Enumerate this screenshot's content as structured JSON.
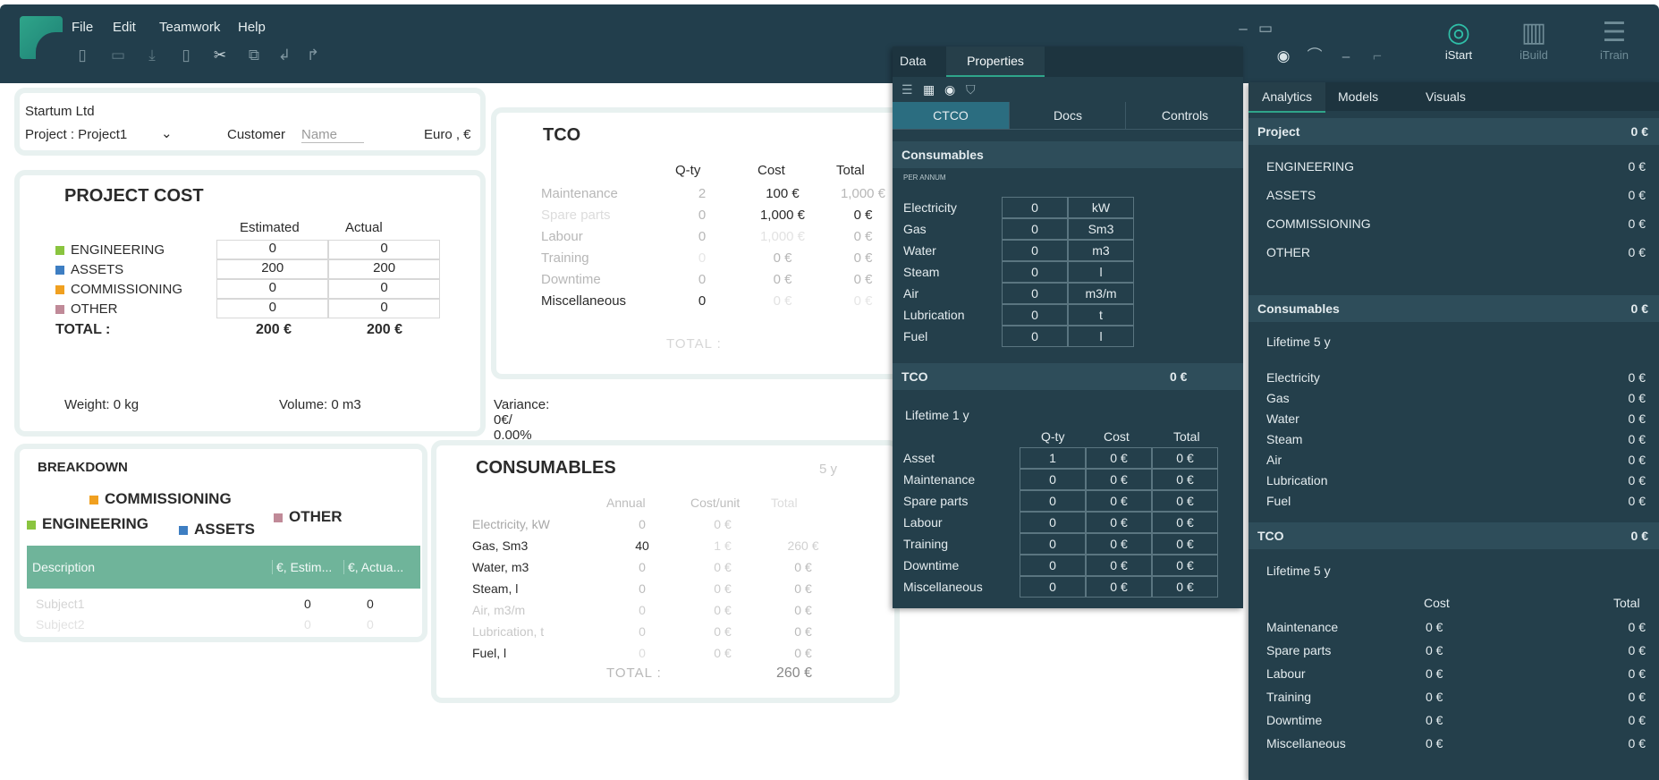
{
  "menu": {
    "file": "File",
    "edit": "Edit",
    "teamwork": "Teamwork",
    "help": "Help"
  },
  "right_toolbar": {
    "istart": "iStart",
    "ibuild": "iBuild",
    "itrain": "iTrain"
  },
  "colors": {
    "engineering": "#8ac43f",
    "assets": "#3e7ec2",
    "commissioning": "#f0a020",
    "other": "#c08a98",
    "accent": "#2fa58a"
  },
  "header": {
    "company": "Startum Ltd",
    "project": "Project : Project1",
    "customer_label": "Customer",
    "customer_placeholder": "Name",
    "currency": "Euro ,  €"
  },
  "project_cost": {
    "title": "PROJECT COST",
    "col_estimated": "Estimated",
    "col_actual": "Actual",
    "rows": [
      {
        "label": "ENGINEERING",
        "estimated": "0",
        "actual": "0"
      },
      {
        "label": "ASSETS",
        "estimated": "200",
        "actual": "200"
      },
      {
        "label": "COMMISSIONING",
        "estimated": "0",
        "actual": "0"
      },
      {
        "label": "OTHER",
        "estimated": "0",
        "actual": "0"
      }
    ],
    "total_label": "TOTAL :",
    "total_estimated": "200 €",
    "total_actual": "200 €",
    "weight": "Weight: 0 kg",
    "volume": "Volume: 0 m3",
    "variance": "Variance: 0€/ 0.00%"
  },
  "tco_card": {
    "title": "TCO",
    "col_qty": "Q-ty",
    "col_cost": "Cost",
    "col_total": "Total",
    "rows": [
      {
        "label": "Maintenance",
        "qty": "2",
        "cost": "100 €",
        "total": "1,000 €"
      },
      {
        "label": "Spare parts",
        "qty": "0",
        "cost": "1,000 €",
        "total": "0 €"
      },
      {
        "label": "Labour",
        "qty": "0",
        "cost": "1,000 €",
        "total": "0 €"
      },
      {
        "label": "Training",
        "qty": "0",
        "cost": "0 €",
        "total": "0 €"
      },
      {
        "label": "Downtime",
        "qty": "0",
        "cost": "0 €",
        "total": "0 €"
      },
      {
        "label": "Miscellaneous",
        "qty": "0",
        "cost": "0 €",
        "total": "0 €"
      }
    ],
    "total_label": "TOTAL :"
  },
  "breakdown": {
    "title": "BREAKDOWN",
    "legend_commissioning": "COMMISSIONING",
    "legend_engineering": "ENGINEERING",
    "legend_assets": "ASSETS",
    "legend_other": "OTHER",
    "col_description": "Description",
    "col_estimated": "€, Estim...",
    "col_actual": "€, Actua...",
    "rows": [
      {
        "description": "Subject1",
        "estimated": "0",
        "actual": "0"
      },
      {
        "description": "Subject2",
        "estimated": "0",
        "actual": "0"
      }
    ]
  },
  "consumables_card": {
    "title": "CONSUMABLES",
    "lifetime": "5  y",
    "col_annual": "Annual",
    "col_cost_unit": "Cost/unit",
    "col_total": "Total",
    "rows": [
      {
        "label": "Electricity, kW",
        "annual": "0",
        "cost": "0 €",
        "total": ""
      },
      {
        "label": "Gas, Sm3",
        "annual": "40",
        "cost": "1 €",
        "total": "260 €"
      },
      {
        "label": "Water, m3",
        "annual": "0",
        "cost": "0 €",
        "total": "0 €"
      },
      {
        "label": "Steam, l",
        "annual": "0",
        "cost": "0 €",
        "total": "0 €"
      },
      {
        "label": "Air, m3/m",
        "annual": "0",
        "cost": "0 €",
        "total": "0 €"
      },
      {
        "label": "Lubrication, t",
        "annual": "0",
        "cost": "0 €",
        "total": "0 €"
      },
      {
        "label": "Fuel, l",
        "annual": "0",
        "cost": "0 €",
        "total": "0 €"
      }
    ],
    "total_label": "TOTAL :",
    "total_value": "260 €"
  },
  "props_panel": {
    "tab_data": "Data",
    "tab_properties": "Properties",
    "subtab_ctco": "CTCO",
    "subtab_docs": "Docs",
    "subtab_controls": "Controls",
    "consumables_title": "Consumables",
    "per_annum": "PER ANNUM",
    "consumables": [
      {
        "label": "Electricity",
        "value": "0",
        "unit": "kW"
      },
      {
        "label": "Gas",
        "value": "0",
        "unit": "Sm3"
      },
      {
        "label": "Water",
        "value": "0",
        "unit": "m3"
      },
      {
        "label": "Steam",
        "value": "0",
        "unit": "l"
      },
      {
        "label": "Air",
        "value": "0",
        "unit": "m3/m"
      },
      {
        "label": "Lubrication",
        "value": "0",
        "unit": "t"
      },
      {
        "label": "Fuel",
        "value": "0",
        "unit": "l"
      }
    ],
    "tco_title": "TCO",
    "tco_total": "0 €",
    "lifetime": "Lifetime 1   y",
    "col_qty": "Q-ty",
    "col_cost": "Cost",
    "col_total": "Total",
    "tco_rows": [
      {
        "label": "Asset",
        "qty": "1",
        "cost": "0 €",
        "total": "0 €"
      },
      {
        "label": "Maintenance",
        "qty": "0",
        "cost": "0 €",
        "total": "0 €"
      },
      {
        "label": "Spare parts",
        "qty": "0",
        "cost": "0 €",
        "total": "0 €"
      },
      {
        "label": "Labour",
        "qty": "0",
        "cost": "0 €",
        "total": "0 €"
      },
      {
        "label": "Training",
        "qty": "0",
        "cost": "0 €",
        "total": "0 €"
      },
      {
        "label": "Downtime",
        "qty": "0",
        "cost": "0 €",
        "total": "0 €"
      },
      {
        "label": "Miscellaneous",
        "qty": "0",
        "cost": "0 €",
        "total": "0 €"
      }
    ]
  },
  "analytics_panel": {
    "tab_analytics": "Analytics",
    "tab_models": "Models",
    "tab_visuals": "Visuals",
    "project_title": "Project",
    "project_total": "0 €",
    "project_rows": [
      {
        "label": "ENGINEERING",
        "value": "0 €"
      },
      {
        "label": "ASSETS",
        "value": "0 €"
      },
      {
        "label": "COMMISSIONING",
        "value": "0 €"
      },
      {
        "label": "OTHER",
        "value": "0 €"
      }
    ],
    "consumables_title": "Consumables",
    "consumables_total": "0 €",
    "consumables_lifetime": "Lifetime  5  y",
    "consumables_rows": [
      {
        "label": "Electricity",
        "value": "0 €"
      },
      {
        "label": "Gas",
        "value": "0 €"
      },
      {
        "label": "Water",
        "value": "0 €"
      },
      {
        "label": "Steam",
        "value": "0 €"
      },
      {
        "label": "Air",
        "value": "0 €"
      },
      {
        "label": "Lubrication",
        "value": "0 €"
      },
      {
        "label": "Fuel",
        "value": "0 €"
      }
    ],
    "tco_title": "TCO",
    "tco_total": "0 €",
    "tco_lifetime": "Lifetime  5  y",
    "col_cost": "Cost",
    "col_total": "Total",
    "tco_rows": [
      {
        "label": "Maintenance",
        "cost": "0 €",
        "total": "0 €"
      },
      {
        "label": "Spare parts",
        "cost": "0 €",
        "total": "0 €"
      },
      {
        "label": "Labour",
        "cost": "0 €",
        "total": "0 €"
      },
      {
        "label": "Training",
        "cost": "0 €",
        "total": "0 €"
      },
      {
        "label": "Downtime",
        "cost": "0 €",
        "total": "0 €"
      },
      {
        "label": "Miscellaneous",
        "cost": "0 €",
        "total": "0 €"
      }
    ]
  }
}
